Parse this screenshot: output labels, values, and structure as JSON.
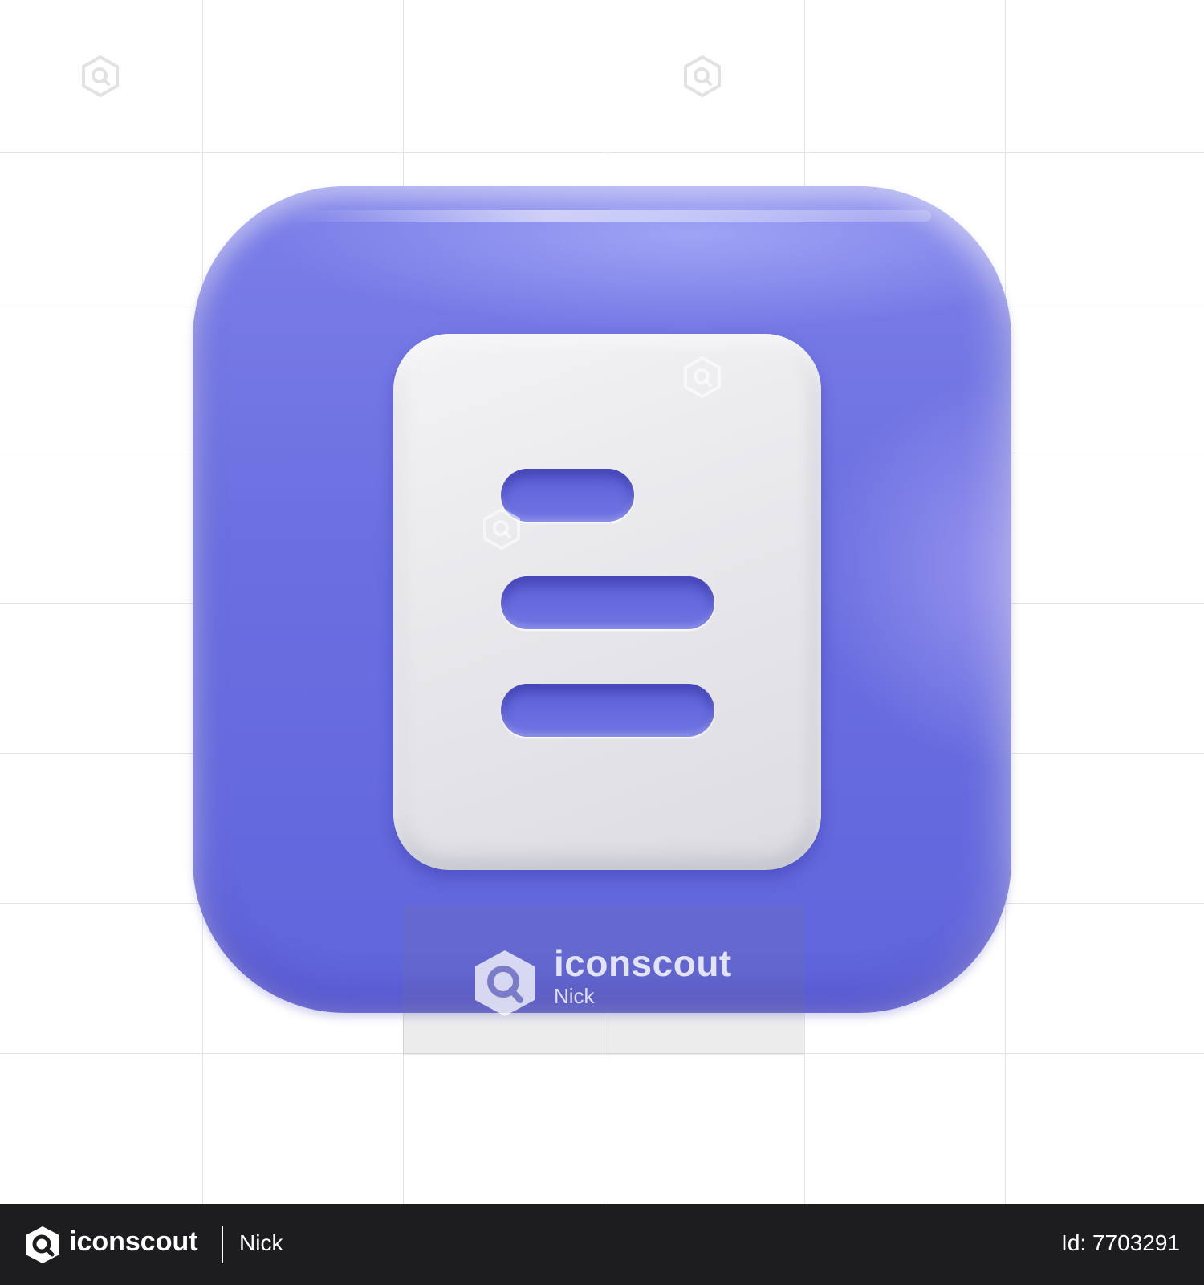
{
  "canvas": {
    "background_color": "#ffffff",
    "grid_color": "#e3e3e3"
  },
  "icon": {
    "name": "document",
    "tile_color": "#6a6ee0",
    "sheet_color": "#e8e8ec",
    "line_color": "#6266dc",
    "line_count": 3
  },
  "watermark": {
    "brand": "iconscout",
    "author": "Nick"
  },
  "footer": {
    "brand": "iconscout",
    "author": "Nick",
    "id_text": "Id: 7703291",
    "background_color": "#1d1d1f",
    "text_color": "#ffffff"
  }
}
